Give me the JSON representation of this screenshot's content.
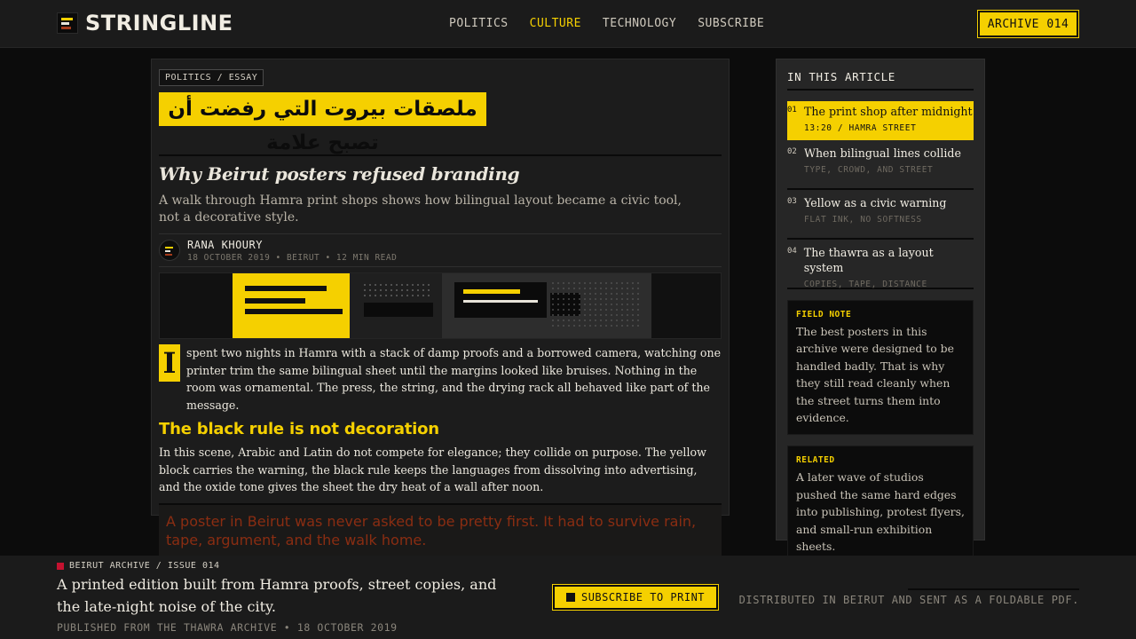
{
  "header": {
    "brand": "STRINGLINE",
    "nav": [
      "POLITICS",
      "CULTURE",
      "TECHNOLOGY",
      "SUBSCRIBE"
    ],
    "active_nav": "CULTURE",
    "archive_label": "ARCHIVE 014"
  },
  "article": {
    "kicker": "POLITICS / ESSAY",
    "arabic_title": "ملصقات بيروت التي رفضت أن تصبح علامة",
    "headline": "Why Beirut posters refused branding",
    "dek": "A walk through Hamra print shops shows how bilingual layout became a civic tool, not a decorative style.",
    "author": "RANA KHOURY",
    "meta": "18 OCTOBER 2019 • BEIRUT • 12 MIN READ",
    "dropcap": "I",
    "lead": "spent two nights in Hamra with a stack of damp proofs and a borrowed camera, watching one printer trim the same bilingual sheet until the margins looked like bruises. Nothing in the room was ornamental. The press, the string, and the drying rack all behaved like part of the message.",
    "subhead": "The black rule is not decoration",
    "body": "In this scene, Arabic and Latin do not compete for elegance; they collide on purpose. The yellow block carries the warning, the black rule keeps the languages from dissolving into advertising, and the oxide tone gives the sheet the dry heat of a wall after noon.",
    "pull_quote": "A poster in Beirut was never asked to be pretty first. It had to survive rain, tape, argument, and the walk home."
  },
  "toc": {
    "title": "IN THIS ARTICLE",
    "items": [
      {
        "num": "01",
        "title": "The print shop after midnight",
        "sub": "13:20 / HAMRA STREET"
      },
      {
        "num": "02",
        "title": "When bilingual lines collide",
        "sub": "TYPE, CROWD, AND STREET"
      },
      {
        "num": "03",
        "title": "Yellow as a civic warning",
        "sub": "FLAT INK, NO SOFTNESS"
      },
      {
        "num": "04",
        "title": "The thawra as a layout system",
        "sub": "COPIES, TAPE, DISTANCE"
      }
    ],
    "field_note_label": "FIELD NOTE",
    "field_note": "The best posters in this archive were designed to be handled badly. That is why they still read cleanly when the street turns them into evidence.",
    "related_label": "RELATED",
    "related": "A later wave of studios pushed the same hard edges into publishing, protest flyers, and small-run exhibition sheets."
  },
  "footer": {
    "kicker": "BEIRUT ARCHIVE / ISSUE 014",
    "text": "A printed edition built from Hamra proofs, street copies, and the late-night noise of the city.",
    "published": "PUBLISHED FROM THE THAWRA ARCHIVE • 18 OCTOBER 2019",
    "subscribe_label": "SUBSCRIBE TO PRINT",
    "distribution": "DISTRIBUTED IN BEIRUT AND SENT AS A FOLDABLE PDF."
  },
  "colors": {
    "accent": "#f5d000",
    "oxide": "#8a2d12",
    "background": "#0c0c0c",
    "panel": "#1c1c1c"
  }
}
